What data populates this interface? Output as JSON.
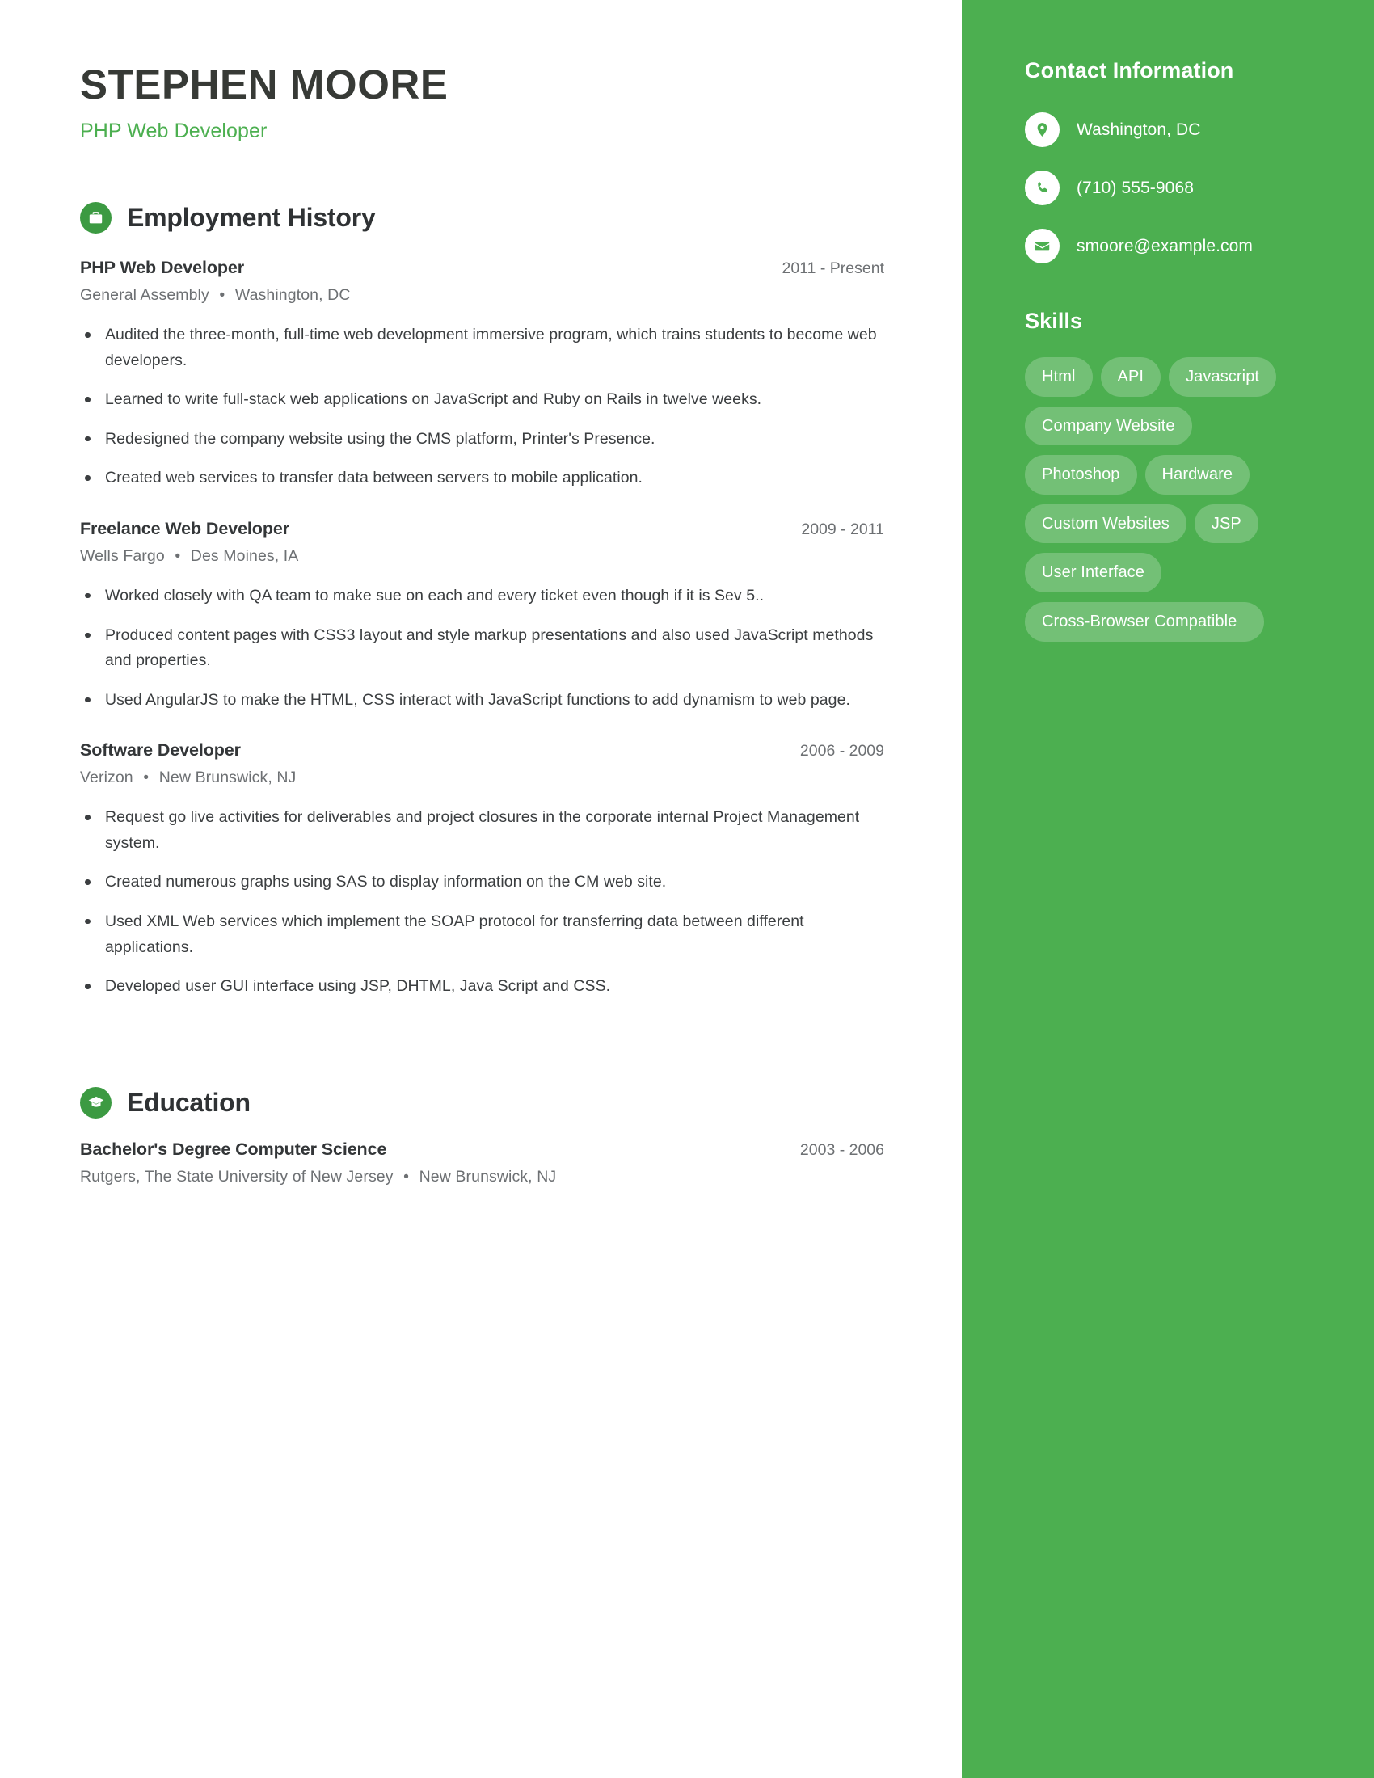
{
  "header": {
    "name": "STEPHEN MOORE",
    "title": "PHP Web Developer"
  },
  "colors": {
    "accent_green": "#4caf50",
    "icon_green": "#3c9a42",
    "heading_dark": "#2f3234",
    "body_text": "#3b3e40",
    "muted_text": "#6d7073"
  },
  "sections": {
    "employment": {
      "title": "Employment History",
      "icon": "briefcase-icon",
      "entries": [
        {
          "role": "PHP Web Developer",
          "dates": "2011 - Present",
          "company": "General Assembly",
          "location": "Washington, DC",
          "bullets": [
            "Audited the three-month, full-time web development immersive program, which trains students to become web developers.",
            "Learned to write full-stack web applications on JavaScript and Ruby on Rails in twelve weeks.",
            "Redesigned the company website using the CMS platform, Printer's Presence.",
            "Created web services to transfer data between servers to mobile application."
          ]
        },
        {
          "role": "Freelance Web Developer",
          "dates": "2009 - 2011",
          "company": "Wells Fargo",
          "location": "Des Moines, IA",
          "bullets": [
            "Worked closely with QA team to make sue on each and every ticket even though if it is Sev 5..",
            "Produced content pages with CSS3 layout and style markup presentations and also used JavaScript methods and properties.",
            "Used AngularJS to make the HTML, CSS interact with JavaScript functions to add dynamism to web page."
          ]
        },
        {
          "role": "Software Developer",
          "dates": "2006 - 2009",
          "company": "Verizon",
          "location": "New Brunswick, NJ",
          "bullets": [
            "Request go live activities for deliverables and project closures in the corporate internal Project Management system.",
            "Created numerous graphs using SAS to display information on the CM web site.",
            "Used XML Web services which implement the SOAP protocol for transferring data between different applications.",
            "Developed user GUI interface using JSP, DHTML, Java Script and CSS."
          ]
        }
      ]
    },
    "education": {
      "title": "Education",
      "icon": "graduation-cap-icon",
      "entries": [
        {
          "degree": "Bachelor's Degree Computer Science",
          "dates": "2003 - 2006",
          "school": "Rutgers, The State University of New Jersey",
          "location": "New Brunswick, NJ"
        }
      ]
    }
  },
  "sidebar": {
    "contact": {
      "title": "Contact Information",
      "items": [
        {
          "icon": "location-pin-icon",
          "value": "Washington, DC"
        },
        {
          "icon": "phone-icon",
          "value": "(710) 555-9068"
        },
        {
          "icon": "envelope-icon",
          "value": "smoore@example.com"
        }
      ]
    },
    "skills": {
      "title": "Skills",
      "items": [
        "Html",
        "API",
        "Javascript",
        "Company Website",
        "Photoshop",
        "Hardware",
        "Custom Websites",
        "JSP",
        "User Interface",
        "Cross-Browser Compatible"
      ]
    }
  },
  "separator": "•"
}
